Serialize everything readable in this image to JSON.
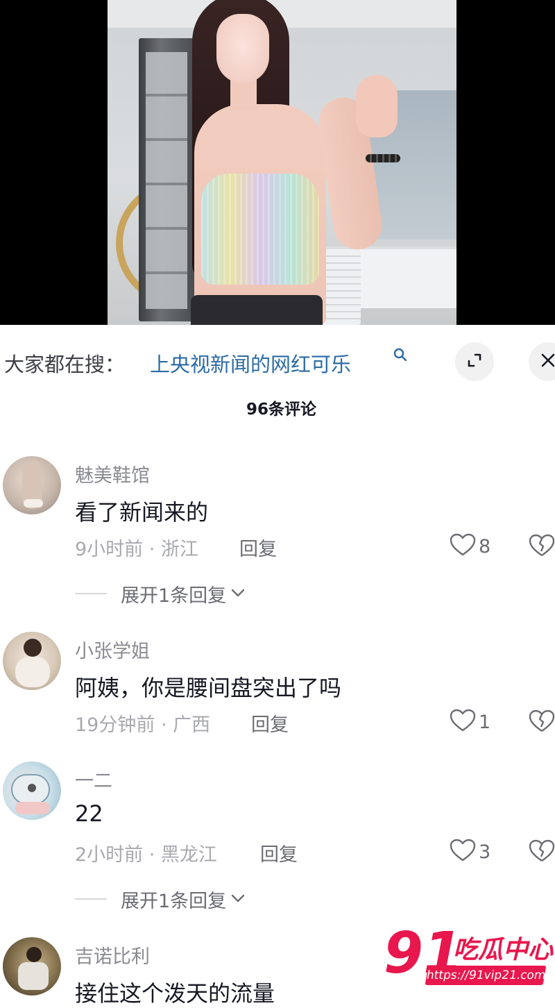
{
  "search": {
    "prefix": "大家都在搜：",
    "query": "上央视新闻的网红可乐",
    "search_icon": "search-icon",
    "expand_icon": "expand-icon",
    "close_icon": "close-icon"
  },
  "comments_header": {
    "count_label": "96条评论"
  },
  "comments": [
    {
      "username": "魅美鞋馆",
      "text": "看了新闻来的",
      "meta": "9小时前 · 浙江",
      "reply_label": "回复",
      "likes": "8",
      "expand_label": "展开1条回复"
    },
    {
      "username": "小张学姐",
      "text": "阿姨，你是腰间盘突出了吗",
      "meta": "19分钟前 · 广西",
      "reply_label": "回复",
      "likes": "1"
    },
    {
      "username": "一二",
      "text": "22",
      "meta": "2小时前 · 黑龙江",
      "reply_label": "回复",
      "likes": "3",
      "expand_label": "展开1条回复"
    },
    {
      "username": "吉诺比利",
      "text": "接住这个泼天的流量"
    }
  ],
  "watermark": {
    "number": "91",
    "name": "吃瓜中心",
    "url": "https://91vip21.com"
  },
  "colors": {
    "link": "#2b6ba5",
    "watermark": "#e8174d"
  }
}
